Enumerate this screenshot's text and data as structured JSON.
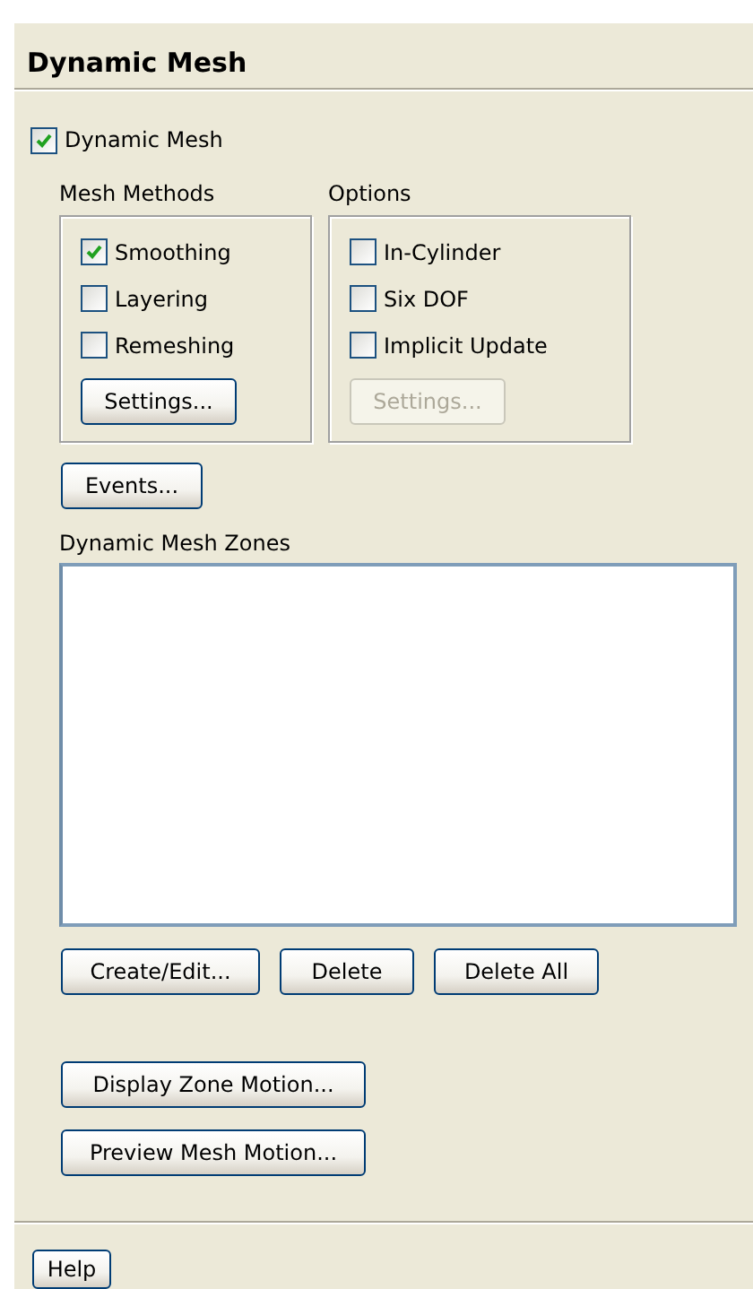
{
  "panel": {
    "title": "Dynamic Mesh"
  },
  "dynamic_mesh": {
    "label": "Dynamic Mesh",
    "checked": true
  },
  "groups": [
    {
      "title": "Mesh Methods",
      "options": [
        {
          "label": "Smoothing",
          "checked": true
        },
        {
          "label": "Layering",
          "checked": false
        },
        {
          "label": "Remeshing",
          "checked": false
        }
      ],
      "button": {
        "label": "Settings...",
        "disabled": false
      }
    },
    {
      "title": "Options",
      "options": [
        {
          "label": "In-Cylinder",
          "checked": false
        },
        {
          "label": "Six DOF",
          "checked": false
        },
        {
          "label": "Implicit Update",
          "checked": false
        }
      ],
      "button": {
        "label": "Settings...",
        "disabled": true
      }
    }
  ],
  "events_button": "Events...",
  "zones": {
    "title": "Dynamic Mesh Zones"
  },
  "zone_buttons": [
    "Create/Edit...",
    "Delete",
    "Delete All"
  ],
  "motion_buttons": [
    "Display Zone Motion...",
    "Preview Mesh Motion..."
  ],
  "help_button": "Help"
}
